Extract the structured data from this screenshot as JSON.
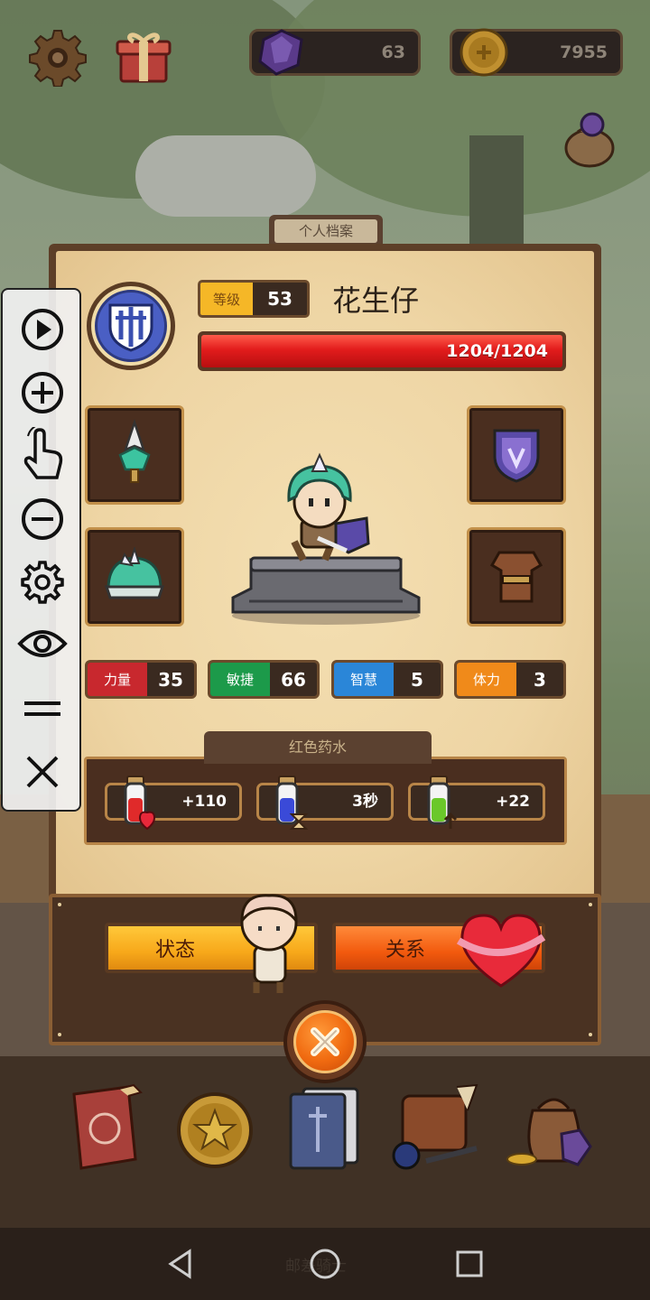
{
  "hud": {
    "gems": "63",
    "coins": "7955"
  },
  "profile": {
    "tab_title": "个人档案",
    "level_label": "等级",
    "level_value": "53",
    "hero_name": "花生仔",
    "hp_text": "1204/1204",
    "hp_fraction": 1.0
  },
  "stats": [
    {
      "label": "力量",
      "value": "35",
      "color": "#c8282e"
    },
    {
      "label": "敏捷",
      "value": "66",
      "color": "#1c9a4a"
    },
    {
      "label": "智慧",
      "value": "5",
      "color": "#2a86d8"
    },
    {
      "label": "体力",
      "value": "3",
      "color": "#f08a1a"
    }
  ],
  "potions": {
    "title": "红色药水",
    "items": [
      {
        "name": "red-potion",
        "value": "+110"
      },
      {
        "name": "blue-potion",
        "value": "3秒"
      },
      {
        "name": "green-potion",
        "value": "+22"
      }
    ]
  },
  "buttons": {
    "status": "状态",
    "relations": "关系"
  },
  "toolbar_icons": [
    "play-icon",
    "zoom-in-icon",
    "touch-icon",
    "zoom-out-icon",
    "settings-icon",
    "eye-icon",
    "menu-icon",
    "close-icon"
  ],
  "bottom_menu_icons": [
    "hero-book-icon",
    "star-coin-icon",
    "card-deck-icon",
    "backpack-icon",
    "treasure-bag-icon"
  ],
  "watermark": "邮差骑士",
  "colors": {
    "hp": "#e21c1c",
    "level": "#f5b727",
    "status_button": "#f7a81a",
    "relations_button": "#f25a0e"
  }
}
